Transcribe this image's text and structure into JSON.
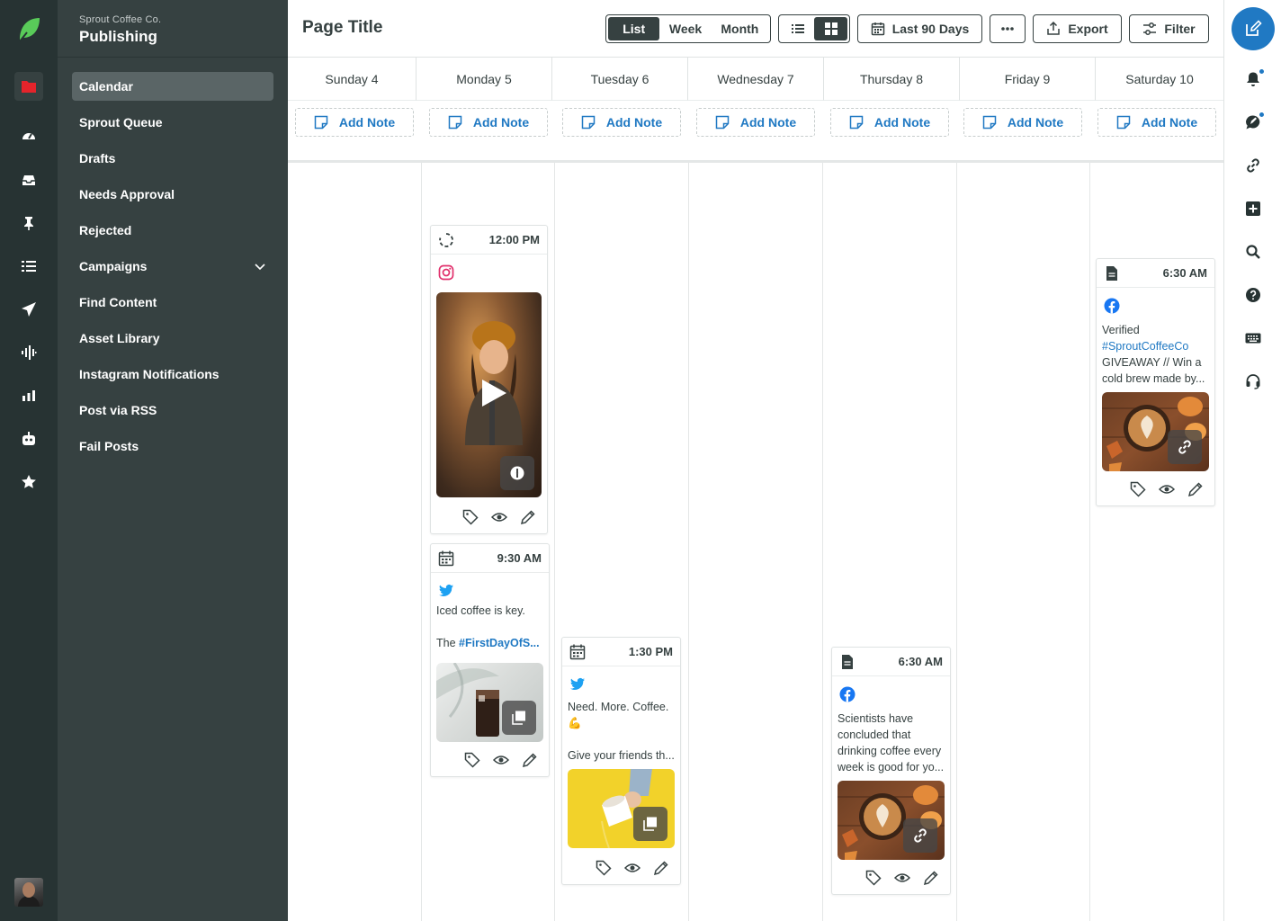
{
  "nav": {
    "company": "Sprout Coffee Co.",
    "section": "Publishing",
    "items": [
      {
        "label": "Calendar"
      },
      {
        "label": "Sprout Queue"
      },
      {
        "label": "Drafts"
      },
      {
        "label": "Needs Approval"
      },
      {
        "label": "Rejected"
      },
      {
        "label": "Campaigns"
      },
      {
        "label": "Find Content"
      },
      {
        "label": "Asset Library"
      },
      {
        "label": "Instagram Notifications"
      },
      {
        "label": "Post via RSS"
      },
      {
        "label": "Fail Posts"
      }
    ]
  },
  "header": {
    "title": "Page Title",
    "view_tabs": [
      "List",
      "Week",
      "Month"
    ],
    "active_view": "List",
    "date_range": "Last 90 Days",
    "export_label": "Export",
    "filter_label": "Filter"
  },
  "days": [
    {
      "label": "Sunday 4"
    },
    {
      "label": "Monday 5"
    },
    {
      "label": "Tuesday 6"
    },
    {
      "label": "Wednesday 7"
    },
    {
      "label": "Thursday 8"
    },
    {
      "label": "Friday 9"
    },
    {
      "label": "Saturday 10"
    }
  ],
  "add_note_label": "Add Note",
  "posts": {
    "mon_ig": {
      "time": "12:00 PM",
      "network": "instagram",
      "status_icon": "processing-icon",
      "media": "video"
    },
    "mon_tw": {
      "time": "9:30 AM",
      "network": "twitter",
      "status_icon": "calendar-icon",
      "text": "Iced coffee is key.",
      "text2_prefix": "The ",
      "text2_tag": "#FirstDayOfS...",
      "media": "gallery"
    },
    "tue_tw": {
      "time": "1:30 PM",
      "network": "twitter",
      "status_icon": "calendar-icon",
      "text": "Need. More. Coffee.",
      "emoji": "💪",
      "text2": "Give your friends th...",
      "media": "gallery"
    },
    "thu_fb": {
      "time": "6:30 AM",
      "network": "facebook",
      "status_icon": "document-icon",
      "text": "Scientists have concluded that drinking coffee every week is good for yo...",
      "media": "link"
    },
    "sat_fb": {
      "time": "6:30 AM",
      "network": "facebook",
      "status_icon": "document-icon",
      "text1": "Verified",
      "tag": "#SproutCoffeeCo",
      "text2": "GIVEAWAY // Win a cold brew made by...",
      "media": "link"
    }
  },
  "colors": {
    "rail": "#273333",
    "nav": "#364141",
    "accent": "#2079c3",
    "twitter": "#1da1f2",
    "facebook": "#1877f2",
    "instagram": "#e1306c",
    "alert": "#e5242b"
  }
}
